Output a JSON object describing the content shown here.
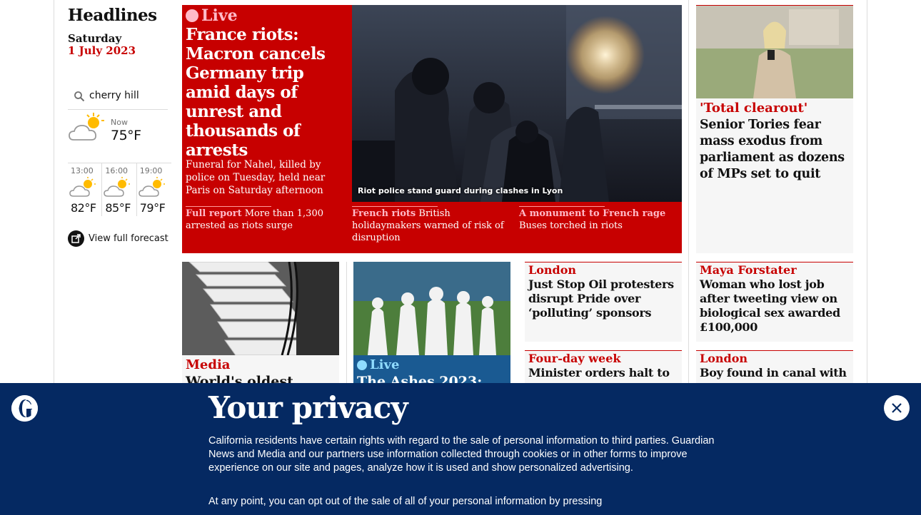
{
  "left": {
    "title": "Headlines",
    "day": "Saturday",
    "date": "1 July 2023"
  },
  "weather": {
    "location": "cherry hill",
    "now_label": "Now",
    "now_temp": "75°F",
    "now_icon": "partly-cloudy-sun-icon",
    "forecast": [
      {
        "time": "13:00",
        "temp": "82°F",
        "icon": "partly-cloudy-sun-icon"
      },
      {
        "time": "16:00",
        "temp": "85°F",
        "icon": "partly-cloudy-sun-icon"
      },
      {
        "time": "19:00",
        "temp": "79°F",
        "icon": "partly-cloudy-sun-icon"
      }
    ],
    "full_forecast_label": "View full forecast"
  },
  "feature": {
    "live_label": "Live",
    "headline": "France riots: Macron cancels Germany trip amid days of unrest and thousands of arrests",
    "standfirst": "Funeral for Nahel, killed by police on Tuesday, held near Paris on Saturday afternoon",
    "photo_caption": "Riot police stand guard during clashes in Lyon",
    "sublinks": [
      {
        "kicker": "Full report",
        "text": "More than 1,300 arrested as riots surge"
      },
      {
        "kicker": "French riots",
        "text": "British holidaymakers warned of risk of disruption"
      },
      {
        "kicker": "A monument to French rage",
        "text": "Buses torched in riots"
      }
    ],
    "colors": {
      "background": "#c70000",
      "kicker": "#ffbac8"
    }
  },
  "right_top": {
    "kicker": "'Total clearout'",
    "headline": "Senior Tories fear mass exodus from parliament as dozens of MPs set to quit"
  },
  "cards": {
    "media": {
      "kicker": "Media",
      "headline": "World's oldest"
    },
    "ashes": {
      "live_label": "Live",
      "headline": "The Ashes 2023:"
    },
    "london1": {
      "kicker": "London",
      "headline": "Just Stop Oil protesters disrupt Pride over ‘polluting’ sponsors"
    },
    "maya": {
      "kicker": "Maya Forstater",
      "headline": "Woman who lost job after tweeting view on biological sex awarded £100,000"
    },
    "fourday": {
      "kicker": "Four-day week",
      "headline": "Minister orders halt to"
    },
    "london2": {
      "kicker": "London",
      "headline": "Boy found in canal with"
    }
  },
  "privacy": {
    "title": "Your privacy",
    "body1": "California residents have certain rights with regard to the sale of personal information to third parties. Guardian News and Media and our partners use information collected through cookies or in other forms to improve experience on our site and pages, analyze how it is used and show personalized advertising.",
    "body2": "At any point, you can opt out of the sale of all of your personal information by pressing",
    "colors": {
      "background": "#052962"
    }
  }
}
